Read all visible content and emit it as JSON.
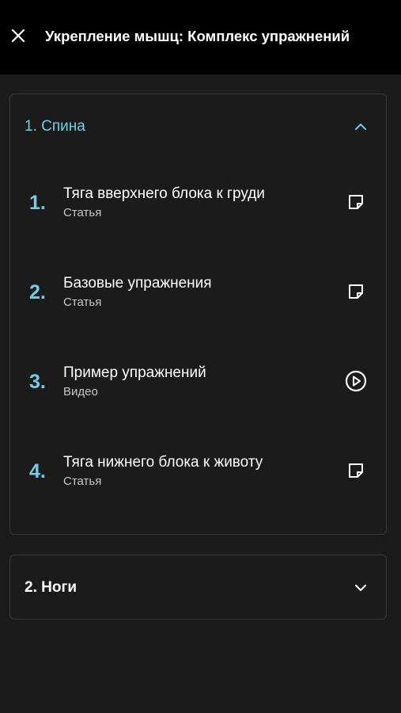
{
  "header": {
    "title": "Укрепление мышц: Комплекс упражнений",
    "close_icon": "close-icon"
  },
  "colors": {
    "accent": "#74cde8",
    "background": "#1b1b1b",
    "topbar": "#000000",
    "border": "#3b3b3b"
  },
  "sections": [
    {
      "title": "1. Спина",
      "expanded": true,
      "chevron_icon": "chevron-up-icon",
      "lessons": [
        {
          "number": "1.",
          "title": "Тяга вверхнего блока к груди",
          "type": "Статья",
          "icon": "article-icon"
        },
        {
          "number": "2.",
          "title": "Базовые упражнения",
          "type": "Статья",
          "icon": "article-icon"
        },
        {
          "number": "3.",
          "title": "Пример упражнений",
          "type": "Видео",
          "icon": "play-icon"
        },
        {
          "number": "4.",
          "title": "Тяга нижнего блока к животу",
          "type": "Статья",
          "icon": "article-icon"
        }
      ]
    },
    {
      "title": "2. Ноги",
      "expanded": false,
      "chevron_icon": "chevron-down-icon"
    }
  ]
}
